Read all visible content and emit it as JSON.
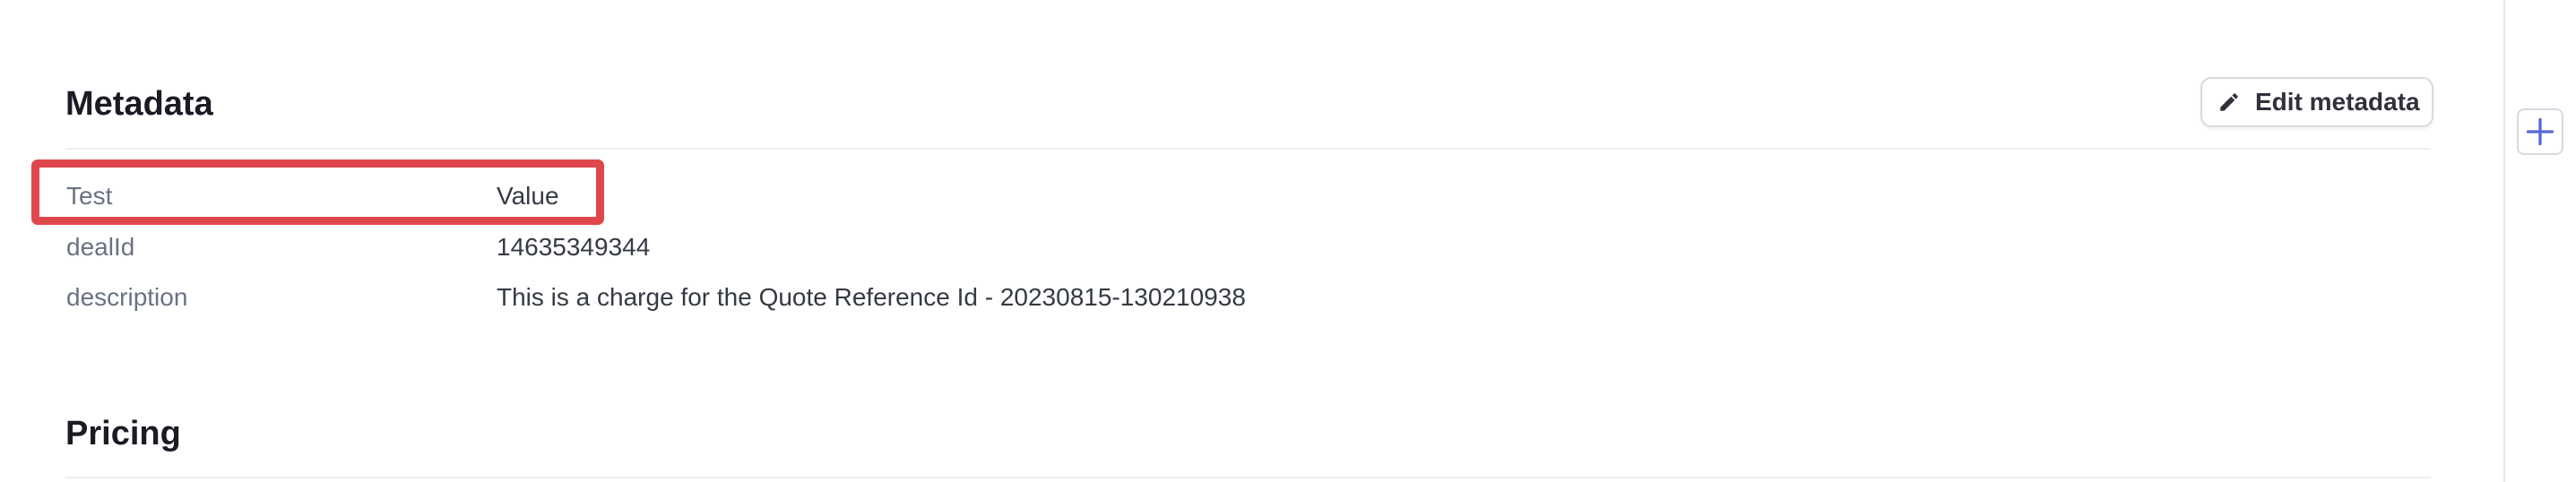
{
  "metadata_section": {
    "title": "Metadata",
    "edit_button_label": "Edit metadata",
    "edit_icon": "pencil-icon",
    "rows": [
      {
        "key": "Test",
        "value": "Value"
      },
      {
        "key": "dealId",
        "value": "14635349344"
      },
      {
        "key": "description",
        "value": "This is a charge for the Quote Reference Id - 20230815-130210938"
      }
    ],
    "highlight_color": "#e0474c"
  },
  "pricing_section": {
    "title": "Pricing"
  },
  "side_rail": {
    "add_icon": "plus-icon",
    "accent_color": "#5469d4"
  }
}
